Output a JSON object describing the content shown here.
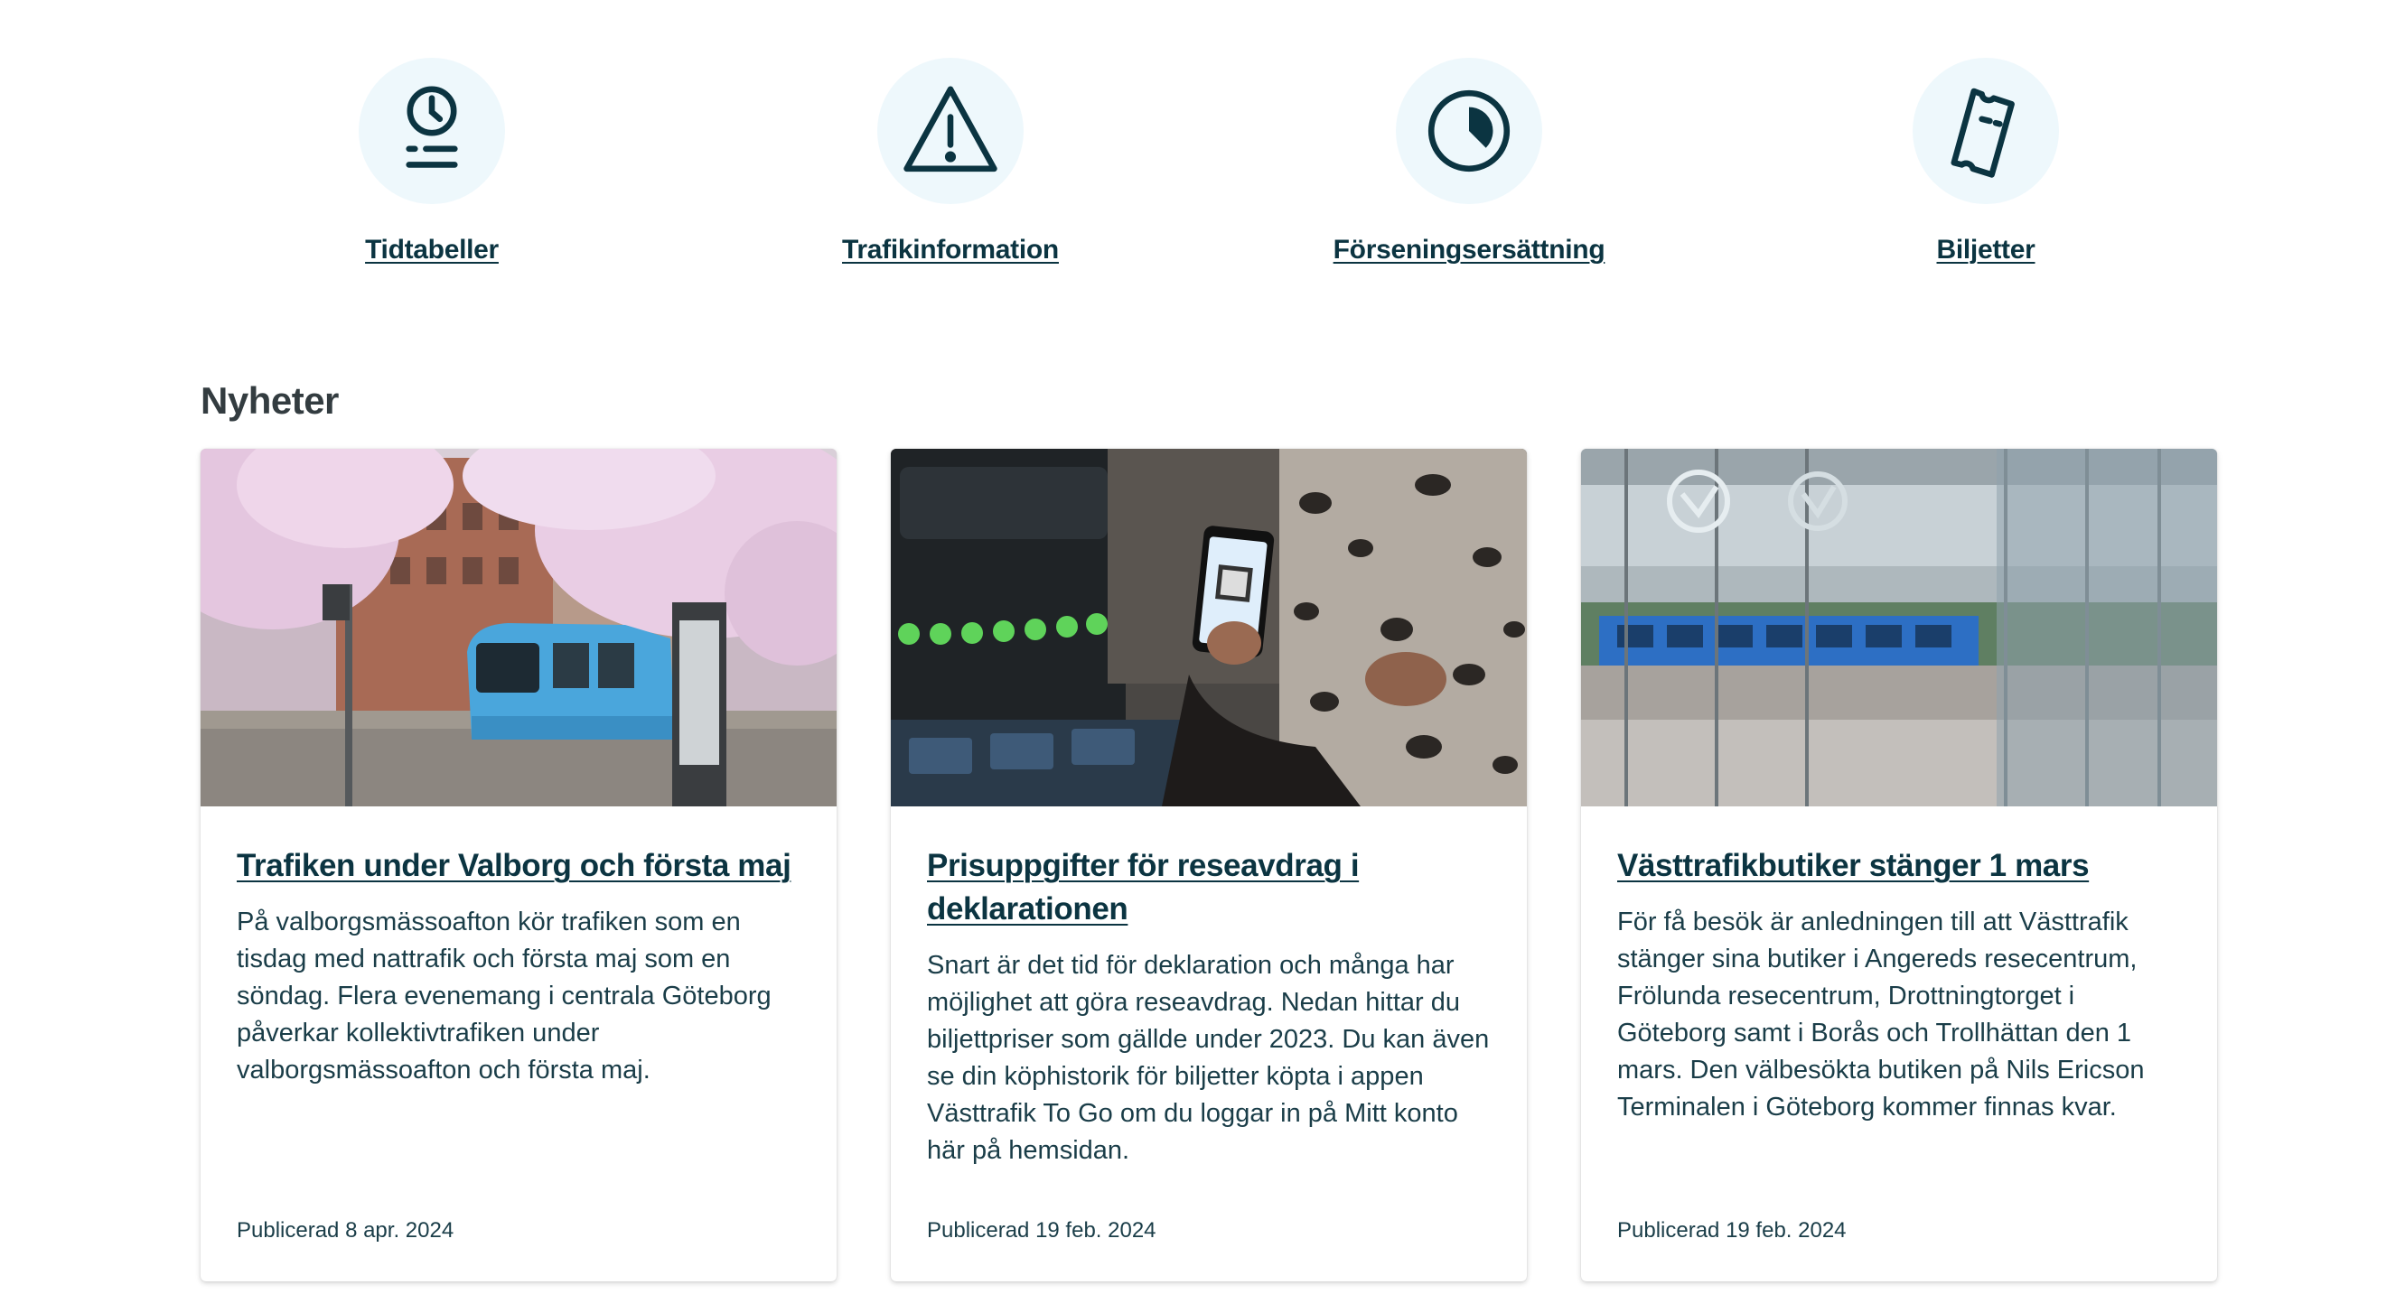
{
  "quicklinks": [
    {
      "label": "Tidtabeller",
      "icon": "timetable-icon"
    },
    {
      "label": "Trafikinformation",
      "icon": "warning-icon"
    },
    {
      "label": "Förseningsersättning",
      "icon": "delay-compensation-icon"
    },
    {
      "label": "Biljetter",
      "icon": "ticket-icon"
    }
  ],
  "news": {
    "heading": "Nyheter",
    "items": [
      {
        "title": "Trafiken under Valborg och första maj",
        "text": "På valborgsmässoafton kör trafiken som en tisdag med nattrafik och första maj som en söndag. Flera evenemang i centrala Göteborg påverkar kollektivtrafiken under valborgsmässoafton och första maj.",
        "date": "Publicerad 8 apr. 2024"
      },
      {
        "title": "Prisuppgifter för reseavdrag i deklarationen",
        "text": "Snart är det tid för deklaration och många har möjlighet att göra reseavdrag. Nedan hittar du biljettpriser som gällde under 2023. Du kan även se din köphistorik för biljetter köpta i appen Västtrafik To Go om du loggar in på Mitt konto här på hemsidan.",
        "date": "Publicerad 19 feb. 2024"
      },
      {
        "title": "Västtrafikbutiker stänger 1 mars",
        "text": "För få besök är anledningen till att Västtrafik stänger sina butiker i Angereds resecentrum, Frölunda resecentrum, Drottningtorget i Göteborg samt i Borås och Trollhättan den 1 mars. Den välbesökta butiken på Nils Ericson Terminalen i Göteborg kommer finnas kvar.",
        "date": "Publicerad 19 feb. 2024"
      }
    ]
  },
  "colors": {
    "primary": "#0b3441",
    "icon_bg": "#eef8fc",
    "tram_blue": "#4aa6dc"
  }
}
